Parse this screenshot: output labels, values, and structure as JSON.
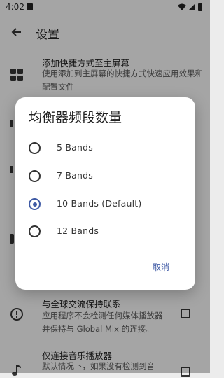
{
  "status_bar": {
    "time": "4:02"
  },
  "app_bar": {
    "title": "设置"
  },
  "settings": [
    {
      "title": "添加快捷方式至主屏幕",
      "desc": "使用添加到主屏幕的快捷方式快速应用效果和配置文件",
      "icon": "grid-icon"
    },
    {
      "title": "与全球交流保持联系",
      "desc": "应用程序不会检测任何媒体播放器并保持与 Global Mix 的连接。",
      "icon": "alert-circle-icon",
      "checked": false
    },
    {
      "title": "仅连接音乐播放器",
      "desc": "默认情况下，如果没有检测到音",
      "icon": "music-note-icon",
      "checked": false
    }
  ],
  "dialog": {
    "title": "均衡器频段数量",
    "options": [
      "5 Bands",
      "7 Bands",
      "10 Bands (Default)",
      "12 Bands"
    ],
    "selected_index": 2,
    "cancel_label": "取消"
  },
  "colors": {
    "accent": "#3f5aa5"
  }
}
